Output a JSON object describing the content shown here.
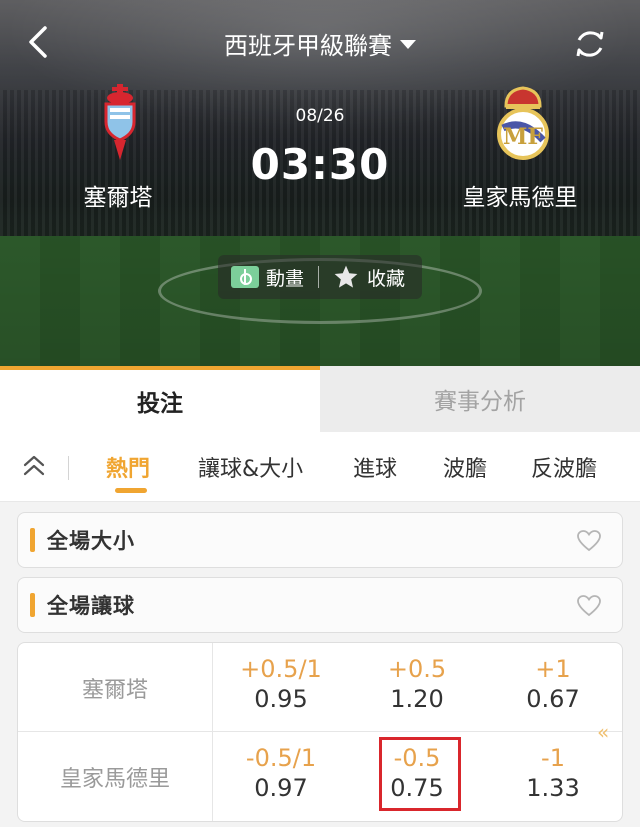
{
  "header": {
    "league": "西班牙甲級聯賽",
    "date": "08/26",
    "time": "03:30",
    "home_team": "塞爾塔",
    "away_team": "皇家馬德里",
    "actions": {
      "animation": "動畫",
      "favorite": "收藏"
    },
    "icons": [
      "back-arrow-icon",
      "refresh-icon",
      "dropdown-caret-icon",
      "celta-crest-icon",
      "real-madrid-crest-icon",
      "pitch-icon",
      "star-icon"
    ]
  },
  "main_tabs": [
    {
      "label": "投注",
      "active": true
    },
    {
      "label": "賽事分析",
      "active": false
    }
  ],
  "sub_tabs": [
    {
      "label": "熱門",
      "active": true
    },
    {
      "label": "讓球&大小",
      "active": false
    },
    {
      "label": "進球",
      "active": false
    },
    {
      "label": "波膽",
      "active": false
    },
    {
      "label": "反波膽",
      "active": false
    }
  ],
  "markets": [
    {
      "title": "全場大小"
    },
    {
      "title": "全場讓球"
    }
  ],
  "handicap_table": {
    "rows": [
      {
        "team": "塞爾塔",
        "odds": [
          {
            "line": "+0.5/1",
            "price": "0.95"
          },
          {
            "line": "+0.5",
            "price": "1.20"
          },
          {
            "line": "+1",
            "price": "0.67"
          }
        ]
      },
      {
        "team": "皇家馬德里",
        "odds": [
          {
            "line": "-0.5/1",
            "price": "0.97"
          },
          {
            "line": "-0.5",
            "price": "0.75",
            "selected": true
          },
          {
            "line": "-1",
            "price": "1.33"
          }
        ]
      }
    ]
  },
  "colors": {
    "accent": "#f0a531",
    "handicap_line": "#e7a24c",
    "selection": "#d9262c"
  }
}
